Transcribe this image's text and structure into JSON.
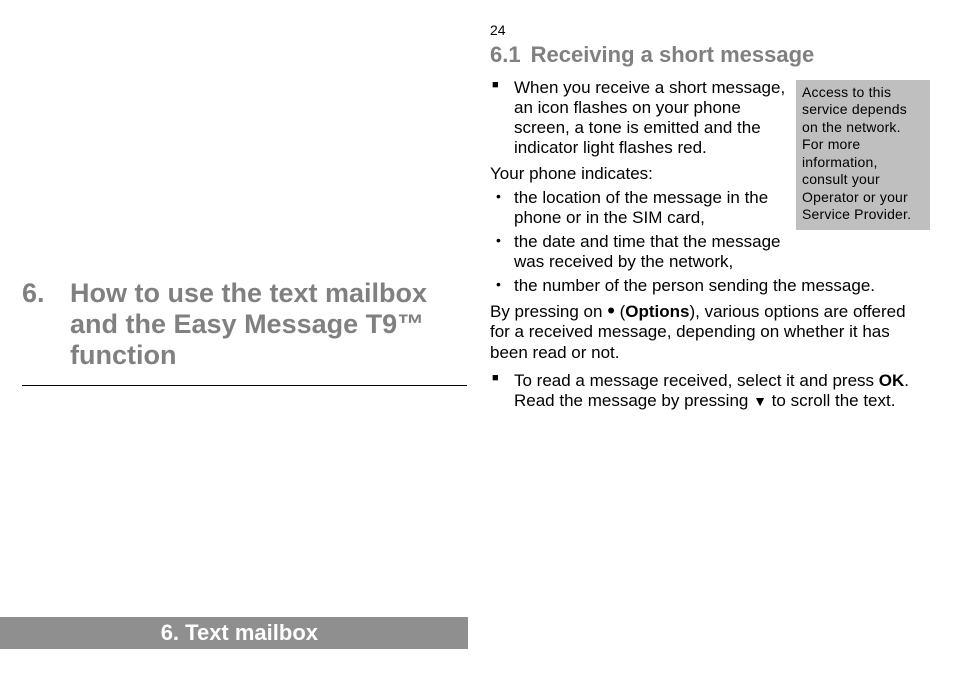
{
  "page_number": "24",
  "chapter": {
    "number": "6.",
    "title": "How to use the text mailbox and the Easy Message T9™ function"
  },
  "footer": "6. Text mailbox",
  "section": {
    "number": "6.1",
    "title": "Receiving a short message"
  },
  "sidebox": "Access to this service depends on the network. For more information, consult your Operator or your Service Provider.",
  "sq1": "When you receive a short message, an icon flashes on your phone screen, a tone is emitted and the indicator light flashes red.",
  "intro": "Your phone indicates:",
  "b1": "the location of the message in the phone or in the SIM card,",
  "b2": "the date and time that the message was received by the network,",
  "b3": "the number of the person sending the message.",
  "para_pre": "By pressing on ",
  "para_options": "Options",
  "para_post": "), various options are offered for a received message, depending on whether it has been read or not.",
  "sq2_a": "To read a message received, select it and press ",
  "sq2_ok": "OK",
  "sq2_b": ". Read the message by pressing ",
  "sq2_c": " to scroll the text."
}
